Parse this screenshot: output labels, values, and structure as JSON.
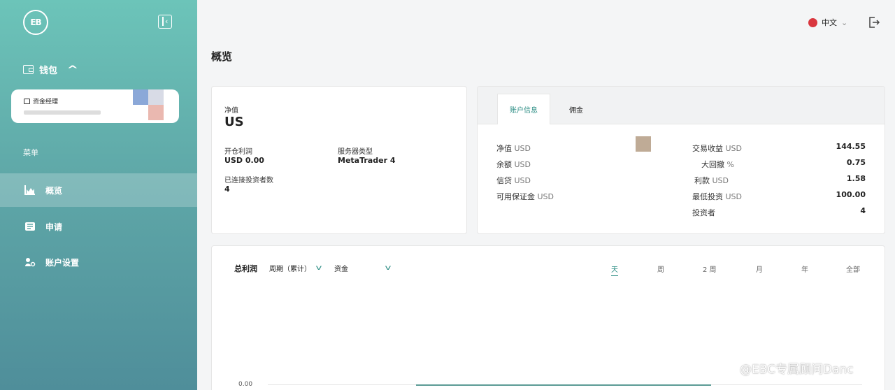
{
  "sidebar": {
    "logo_text": "EB",
    "wallet_label": "钱包",
    "account_title": "资金经理",
    "menu_heading": "菜单",
    "items": [
      {
        "label": "概览",
        "icon": "chart-icon",
        "active": true
      },
      {
        "label": "申请",
        "icon": "application-icon",
        "active": false
      },
      {
        "label": "账户设置",
        "icon": "user-settings-icon",
        "active": false
      }
    ]
  },
  "topbar": {
    "language": "中文",
    "flag_color": "#d9363e"
  },
  "page_title": "概览",
  "summary": {
    "equity_label": "净值",
    "equity_value": "US",
    "open_pl_label": "开仓利润",
    "open_pl_value": "USD 0.00",
    "server_type_label": "服务器类型",
    "server_type_value": "MetaTrader 4",
    "investors_label": "已连接投资者数",
    "investors_value": "4"
  },
  "account_info": {
    "tabs": [
      "账户信息",
      "佣金"
    ],
    "left_rows": [
      {
        "label": "净值",
        "unit": "USD"
      },
      {
        "label": "余额",
        "unit": "USD"
      },
      {
        "label": "信贷",
        "unit": "USD"
      },
      {
        "label": "可用保证金",
        "unit": "USD"
      }
    ],
    "right_rows": [
      {
        "label": "交易收益",
        "unit": "USD",
        "value": "144.55"
      },
      {
        "label": "大回撤",
        "unit": "%",
        "value": "0.75"
      },
      {
        "label": "利款",
        "unit": "USD",
        "value": "1.58"
      },
      {
        "label": "最低投资",
        "unit": "USD",
        "value": "100.00"
      },
      {
        "label": "投资者",
        "unit": "",
        "value": "4"
      }
    ]
  },
  "profit_chart": {
    "title": "总利润",
    "period_select": "周期（累计）",
    "currency_select": "资金",
    "ranges": [
      "天",
      "周",
      "2 周",
      "月",
      "年",
      "全部"
    ],
    "active_range": "天",
    "y_tick": "0.00",
    "accent": "#2f8f86"
  },
  "watermark": "@EBC专属顾问Danc"
}
